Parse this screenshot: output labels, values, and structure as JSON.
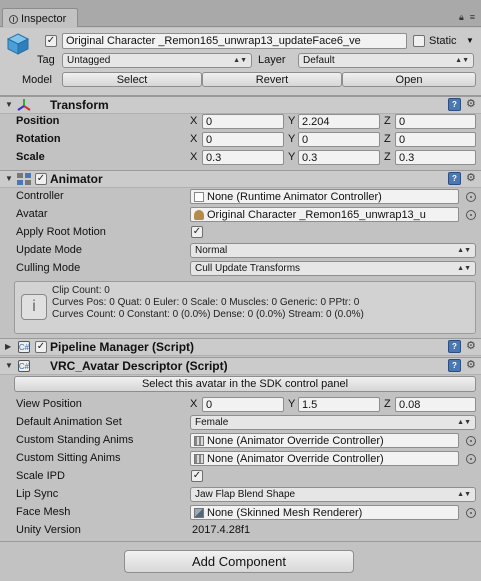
{
  "window": {
    "tab_label": "Inspector"
  },
  "header": {
    "name": "Original Character _Remon165_unwrap13_updateFace6_ve",
    "static_label": "Static",
    "tag_label": "Tag",
    "tag_value": "Untagged",
    "layer_label": "Layer",
    "layer_value": "Default",
    "model_label": "Model",
    "select_btn": "Select",
    "revert_btn": "Revert",
    "open_btn": "Open"
  },
  "transform": {
    "title": "Transform",
    "position_label": "Position",
    "rotation_label": "Rotation",
    "scale_label": "Scale",
    "position": {
      "x": "0",
      "y": "2.204",
      "z": "0"
    },
    "rotation": {
      "x": "0",
      "y": "0",
      "z": "0"
    },
    "scale": {
      "x": "0.3",
      "y": "0.3",
      "z": "0.3"
    }
  },
  "axis": {
    "x": "X",
    "y": "Y",
    "z": "Z"
  },
  "animator": {
    "title": "Animator",
    "controller_label": "Controller",
    "controller_value": "None (Runtime Animator Controller)",
    "avatar_label": "Avatar",
    "avatar_value": "Original Character _Remon165_unwrap13_u",
    "apply_root_motion_label": "Apply Root Motion",
    "update_mode_label": "Update Mode",
    "update_mode_value": "Normal",
    "culling_mode_label": "Culling Mode",
    "culling_mode_value": "Cull Update Transforms",
    "info": {
      "line1": "Clip Count: 0",
      "line2": "Curves Pos: 0 Quat: 0 Euler: 0 Scale: 0 Muscles: 0 Generic: 0 PPtr: 0",
      "line3": "Curves Count: 0 Constant: 0 (0.0%) Dense: 0 (0.0%) Stream: 0 (0.0%)"
    }
  },
  "pipeline": {
    "title": "Pipeline Manager (Script)"
  },
  "descriptor": {
    "title": "VRC_Avatar Descriptor (Script)",
    "select_sdk_btn": "Select this avatar in the SDK control panel",
    "view_position_label": "View Position",
    "view_position": {
      "x": "0",
      "y": "1.5",
      "z": "0.08"
    },
    "default_anim_set_label": "Default Animation Set",
    "default_anim_set_value": "Female",
    "custom_standing_label": "Custom Standing Anims",
    "custom_standing_value": "None (Animator Override Controller)",
    "custom_sitting_label": "Custom Sitting Anims",
    "custom_sitting_value": "None (Animator Override Controller)",
    "scale_ipd_label": "Scale IPD",
    "lip_sync_label": "Lip Sync",
    "lip_sync_value": "Jaw Flap Blend Shape",
    "face_mesh_label": "Face Mesh",
    "face_mesh_value": "None (Skinned Mesh Renderer)",
    "unity_version_label": "Unity Version",
    "unity_version_value": "2017.4.28f1"
  },
  "footer": {
    "add_component_btn": "Add Component"
  },
  "state": {
    "active_checked": true,
    "static_checked": false,
    "animator_enabled": true,
    "apply_root_motion": true,
    "pipeline_enabled": true,
    "scale_ipd": true
  },
  "colors": {
    "panel_bg": "#c2c2c2",
    "header_bg": "#cbcbcb",
    "help_icon": "#4a78b5"
  }
}
